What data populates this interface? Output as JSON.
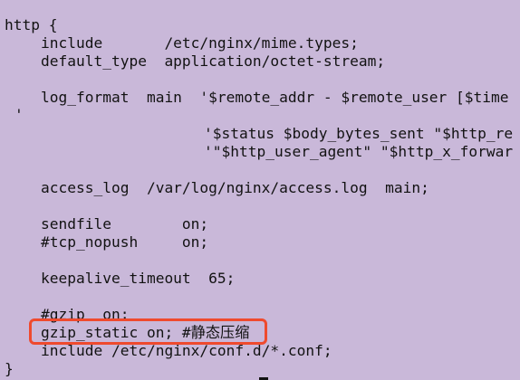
{
  "editor": {
    "lines": [
      "http {",
      "include       /etc/nginx/mime.types;",
      "default_type  application/octet-stream;",
      "log_format  main  '$remote_addr - $remote_user [$time",
      "'",
      "'$status $body_bytes_sent \"$http_re",
      "'\"$http_user_agent\" \"$http_x_forwar",
      "access_log  /var/log/nginx/access.log  main;",
      "sendfile        on;",
      "#tcp_nopush     on;",
      "keepalive_timeout  65;",
      "#gzip  on;",
      "gzip_static on; #静态压缩",
      "include /etc/nginx/conf.d/*.conf;",
      "}"
    ]
  },
  "colors": {
    "background": "#c9b8d9",
    "text": "#121212",
    "highlight": "#ef4a2e"
  }
}
